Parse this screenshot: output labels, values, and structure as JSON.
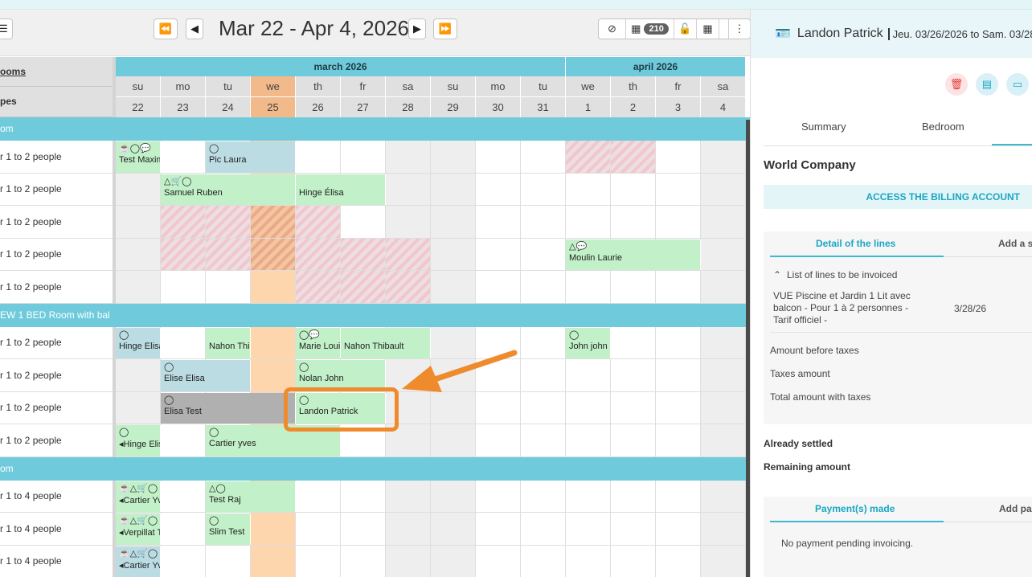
{
  "toolbar": {
    "date_range": "Mar 22 - Apr 4, 2026",
    "badge_count": "210"
  },
  "calendar": {
    "left_headers": [
      "ooms",
      "pes"
    ],
    "months": [
      {
        "name": "march 2026",
        "start": 0,
        "span": 10
      },
      {
        "name": "april 2026",
        "start": 10,
        "span": 4
      }
    ],
    "days": [
      {
        "dow": "su",
        "num": "22"
      },
      {
        "dow": "mo",
        "num": "23"
      },
      {
        "dow": "tu",
        "num": "24"
      },
      {
        "dow": "we",
        "num": "25"
      },
      {
        "dow": "th",
        "num": "26"
      },
      {
        "dow": "fr",
        "num": "27"
      },
      {
        "dow": "sa",
        "num": "28"
      },
      {
        "dow": "su",
        "num": "29"
      },
      {
        "dow": "mo",
        "num": "30"
      },
      {
        "dow": "tu",
        "num": "31"
      },
      {
        "dow": "we",
        "num": "1"
      },
      {
        "dow": "th",
        "num": "2"
      },
      {
        "dow": "fr",
        "num": "3"
      },
      {
        "dow": "sa",
        "num": "4"
      }
    ],
    "today_index": 3,
    "rows": [
      {
        "kind": "cat",
        "label": "om"
      },
      {
        "kind": "room",
        "label": "r 1 to 2 people"
      },
      {
        "kind": "room",
        "label": "r 1 to 2 people"
      },
      {
        "kind": "room",
        "label": "r 1 to 2 people"
      },
      {
        "kind": "room",
        "label": "r 1 to 2 people"
      },
      {
        "kind": "room",
        "label": "r 1 to 2 people"
      },
      {
        "kind": "cat",
        "label": "EW 1 BED Room with bal"
      },
      {
        "kind": "room",
        "label": "r 1 to 2 people"
      },
      {
        "kind": "room",
        "label": "r 1 to 2 people"
      },
      {
        "kind": "room",
        "label": "r 1 to 2 people"
      },
      {
        "kind": "room",
        "label": "r 1 to 2 people"
      },
      {
        "kind": "cat",
        "label": "om"
      },
      {
        "kind": "room",
        "label": "r 1 to 4 people"
      },
      {
        "kind": "room",
        "label": "r 1 to 4 people"
      },
      {
        "kind": "room",
        "label": "r 1 to 4 people"
      }
    ],
    "blocked": [
      {
        "row": 1,
        "days": [
          10,
          11
        ]
      },
      {
        "row": 3,
        "days": [
          1,
          2,
          3,
          4
        ]
      },
      {
        "row": 4,
        "days": [
          1,
          2,
          3,
          4,
          5,
          6
        ]
      },
      {
        "row": 5,
        "days": [
          4,
          5,
          6
        ]
      }
    ],
    "bookings": [
      {
        "row": 1,
        "start": 0,
        "len": 1,
        "color": "green",
        "name": "Test Maxim",
        "icons": "☕◯💬"
      },
      {
        "row": 1,
        "start": 2,
        "len": 2,
        "color": "blue",
        "name": "Pic Laura",
        "icons": "◯"
      },
      {
        "row": 2,
        "start": 1,
        "len": 3,
        "color": "green",
        "name": "Samuel Ruben",
        "icons": "△🛒◯"
      },
      {
        "row": 2,
        "start": 4,
        "len": 2,
        "color": "green",
        "name": "Hinge Élisa",
        "icons": ""
      },
      {
        "row": 4,
        "start": 10,
        "len": 3,
        "color": "green",
        "name": "Moulin Laurie",
        "icons": "△💬"
      },
      {
        "row": 7,
        "start": 0,
        "len": 1,
        "color": "blue",
        "name": "Hinge Elisa",
        "icons": "◯"
      },
      {
        "row": 7,
        "start": 2,
        "len": 1,
        "color": "green",
        "name": "Nahon Thi",
        "icons": ""
      },
      {
        "row": 7,
        "start": 4,
        "len": 1,
        "color": "green",
        "name": "Marie Loui",
        "icons": "◯💬"
      },
      {
        "row": 7,
        "start": 5,
        "len": 2,
        "color": "green",
        "name": "Nahon Thibault",
        "icons": ""
      },
      {
        "row": 7,
        "start": 10,
        "len": 1,
        "color": "green",
        "name": "John john",
        "icons": "◯"
      },
      {
        "row": 8,
        "start": 1,
        "len": 2,
        "color": "blue",
        "name": "Elise Elisa",
        "icons": "◯"
      },
      {
        "row": 8,
        "start": 4,
        "len": 2,
        "color": "green",
        "name": "Nolan John",
        "icons": "◯"
      },
      {
        "row": 9,
        "start": 1,
        "len": 3,
        "color": "gray",
        "name": "Elisa Test",
        "icons": "◯"
      },
      {
        "row": 9,
        "start": 4,
        "len": 2,
        "color": "green",
        "name": "Landon Patrick",
        "icons": "◯"
      },
      {
        "row": 10,
        "start": 0,
        "len": 1,
        "color": "green",
        "name": "◂Hinge Elis",
        "icons": "◯"
      },
      {
        "row": 10,
        "start": 2,
        "len": 3,
        "color": "green",
        "name": "Cartier yves",
        "icons": "◯"
      },
      {
        "row": 12,
        "start": 0,
        "len": 1,
        "color": "green",
        "name": "◂Cartier Yv",
        "icons": "☕△🛒◯"
      },
      {
        "row": 12,
        "start": 2,
        "len": 2,
        "color": "green",
        "name": "Test Raj",
        "icons": "△◯"
      },
      {
        "row": 13,
        "start": 0,
        "len": 1,
        "color": "green",
        "name": "◂Verpillat T",
        "icons": "☕△🛒◯"
      },
      {
        "row": 13,
        "start": 2,
        "len": 1,
        "color": "green",
        "name": "Slim Test",
        "icons": "◯"
      },
      {
        "row": 14,
        "start": 0,
        "len": 1,
        "color": "blue",
        "name": "◂Cartier Yv",
        "icons": "☕△🛒◯"
      }
    ]
  },
  "panel": {
    "guest_name": "Landon Patrick",
    "dates": "Jeu. 03/26/2026 to Sam. 03/28",
    "tabs": [
      "Summary",
      "Bedroom"
    ],
    "company": "World Company",
    "billing_button": "ACCESS THE BILLING ACCOUNT",
    "lines_card": {
      "tab_active": "Detail of the lines",
      "tab_other": "Add a s",
      "list_title": "List of lines to be invoiced",
      "line_desc": "VUE Piscine et Jardin 1 Lit avec balcon - Pour 1 à 2 personnes - Tarif officiel -",
      "line_date": "3/28/26",
      "amount_before": "Amount before taxes",
      "taxes_amount": "Taxes amount",
      "total_amount": "Total amount with taxes"
    },
    "already_settled": "Already settled",
    "remaining": "Remaining amount",
    "payments_card": {
      "tab_active": "Payment(s) made",
      "tab_other": "Add pa",
      "empty": "No payment pending invoicing."
    }
  },
  "colors": {
    "accent": "#3cb8d0",
    "month_bar": "#6fcbdc",
    "today": "#fdd6ae",
    "booking_green": "#c2f0c8",
    "booking_blue": "#bcdce4",
    "highlight": "#ef8b2c",
    "delete": "#e53935"
  }
}
